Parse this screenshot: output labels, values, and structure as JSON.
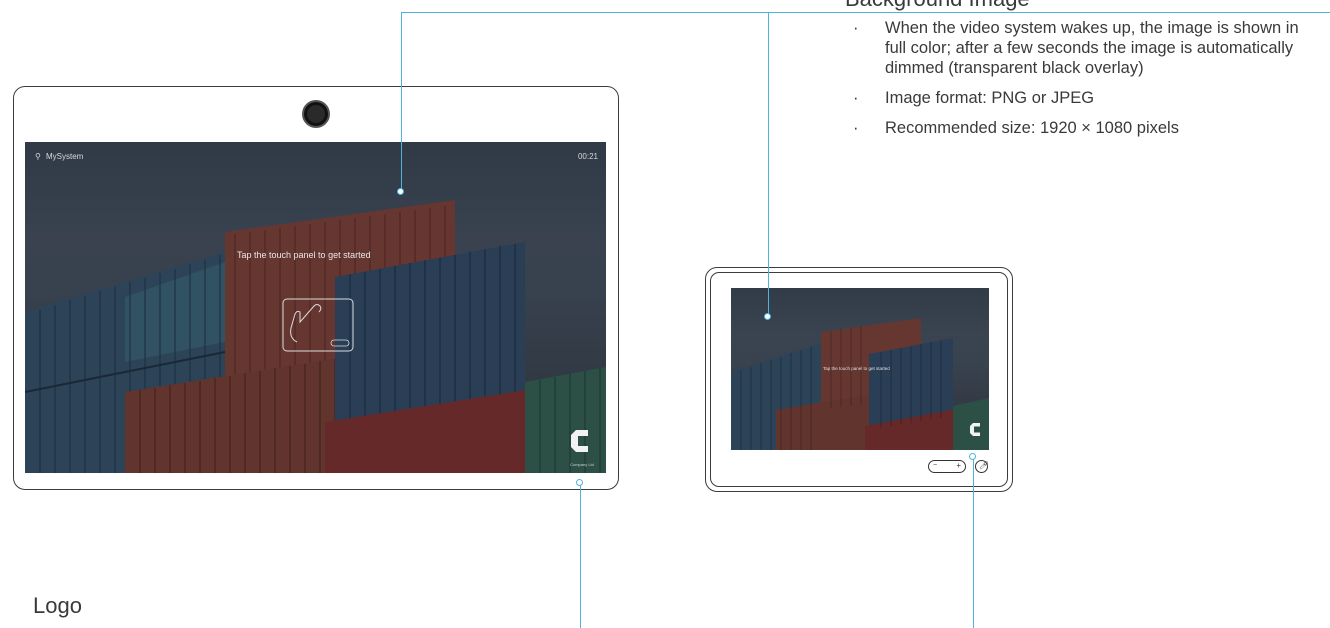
{
  "callout_top": {
    "heading": "Background Image",
    "bullets": [
      "When the video system wakes up, the image is shown in full color; after a few seconds the image is automatically dimmed (transparent black overlay)",
      "Image format: PNG or JPEG",
      "Recommended size: 1920 × 1080 pixels"
    ]
  },
  "callout_bottom": {
    "label": "Logo"
  },
  "screen_large": {
    "system_name": "MySystem",
    "clock": "00:21",
    "prompt": "Tap the touch panel to get started",
    "logo_caption": "Company Ltd"
  },
  "screen_small": {
    "prompt": "Tap the touch panel to get started"
  },
  "colors": {
    "callout": "#4fb3dd"
  }
}
